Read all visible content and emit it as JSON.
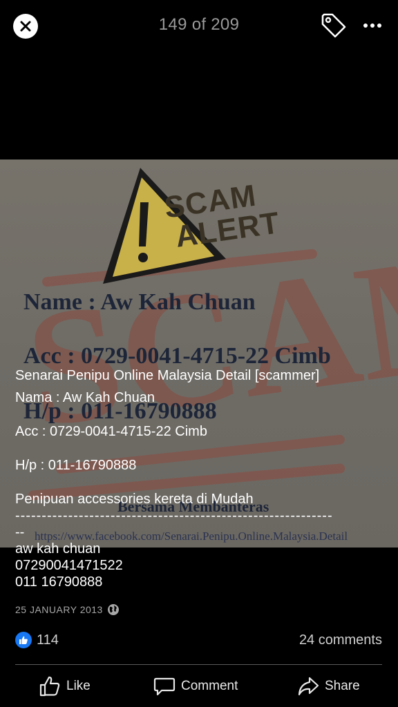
{
  "viewer": {
    "counter": "149 of 209",
    "close_icon": "close-icon",
    "tag_icon": "tag-icon",
    "more_icon": "more-icon"
  },
  "photo": {
    "stamp_line1": "SCAM",
    "stamp_line2": "ALERT",
    "name_line": "Name : Aw Kah Chuan",
    "acc_line": "Acc : 0729-0041-4715-22 Cimb",
    "hp_line": "H/p : 011-16790888",
    "footer_line": "Bersama Membanteras",
    "url_line": "https://www.facebook.com/Senarai.Penipu.Online.Malaysia.Detail"
  },
  "caption": {
    "title": "Senarai Penipu Online Malaysia Detail [scammer]",
    "nama": "Nama : Aw Kah Chuan",
    "acc": "Acc :  0729-0041-4715-22 Cimb",
    "hp": "H/p : 011-16790888",
    "desc": "Penipuan accessories kereta di Mudah",
    "dashes1": "------------------------------------------------------------",
    "dashes2": "--",
    "name2": "aw kah chuan",
    "acc2": "07290041471522",
    "phone2": "011 16790888"
  },
  "meta": {
    "date": "25 JANUARY 2013",
    "privacy_icon": "globe-icon"
  },
  "stats": {
    "likes": "114",
    "comments": "24 comments"
  },
  "actions": {
    "like": "Like",
    "comment": "Comment",
    "share": "Share"
  },
  "colors": {
    "accent": "#1877f2",
    "background": "#000000"
  }
}
